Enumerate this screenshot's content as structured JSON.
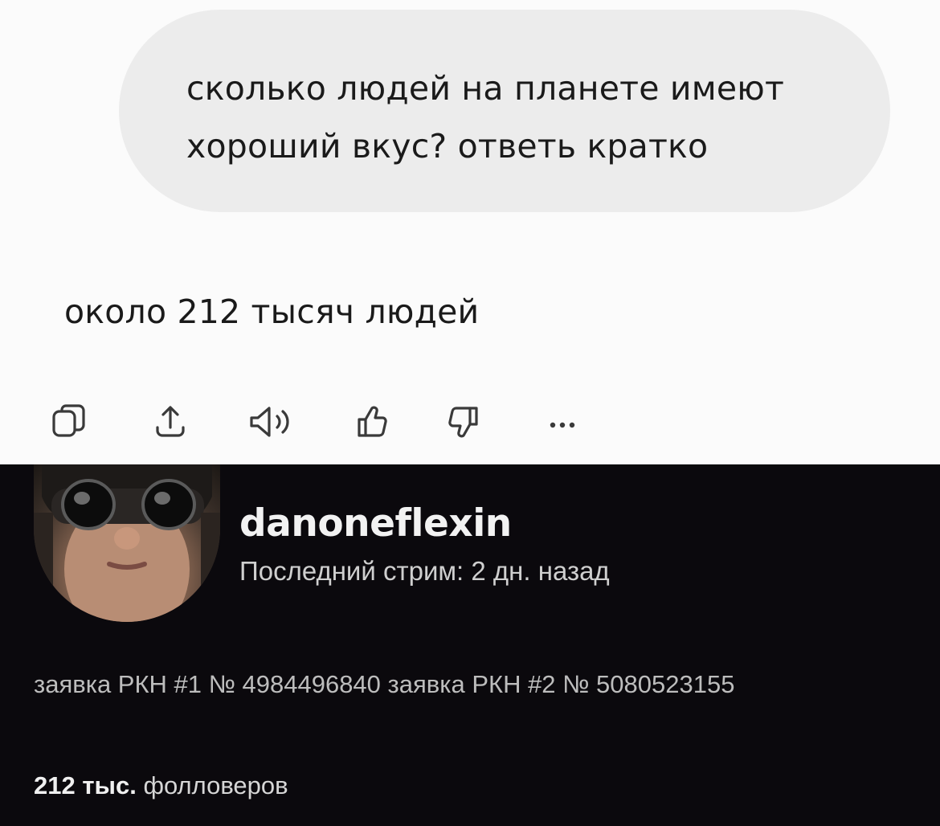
{
  "chat": {
    "question": "сколько людей на планете имеют хороший вкус? ответь кратко",
    "answer": "около 212 тысяч людей",
    "actions": [
      {
        "icon": "copy-icon"
      },
      {
        "icon": "share-icon"
      },
      {
        "icon": "speaker-icon"
      },
      {
        "icon": "thumbs-up-icon"
      },
      {
        "icon": "thumbs-down-icon"
      },
      {
        "icon": "more-icon"
      }
    ]
  },
  "profile": {
    "username": "danoneflexin",
    "last_stream": "Последний стрим: 2 дн. назад",
    "bio": "заявка РКН #1 № 4984496840 заявка РКН #2 № 5080523155",
    "followers_count": "212 тыс.",
    "followers_label": "фолловеров"
  },
  "colors": {
    "chat_bg": "#fbfbfb",
    "bubble_bg": "#ececec",
    "profile_bg": "#0b090d",
    "text_dark": "#1a1a1a",
    "text_light": "#f2f2f2"
  }
}
